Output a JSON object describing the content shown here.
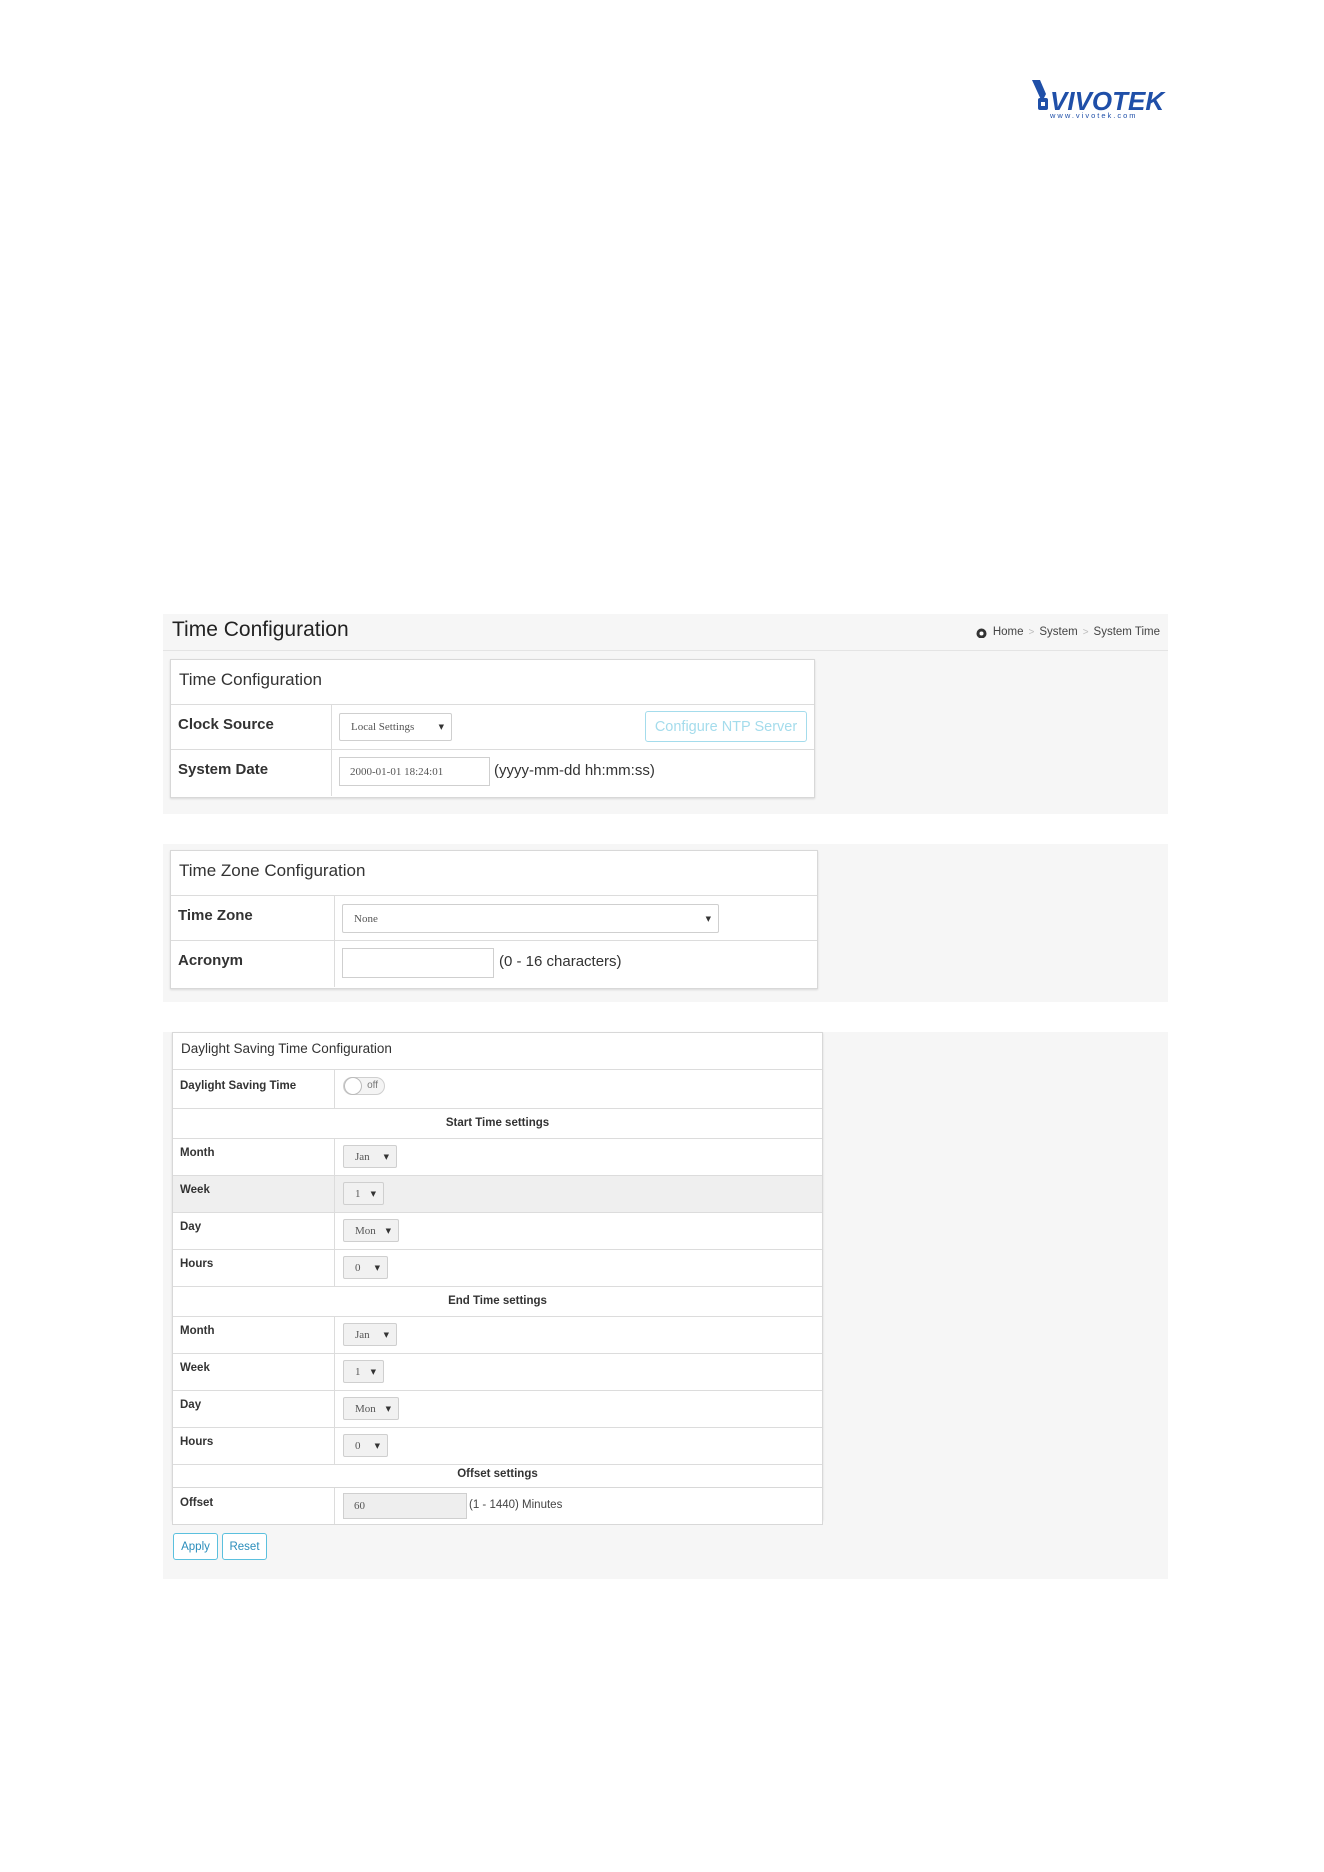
{
  "logo": {
    "brand": "VIVOTEK",
    "url": "www.vivotek.com"
  },
  "page": {
    "title": "Time Configuration",
    "breadcrumb": [
      "Home",
      "System",
      "System Time"
    ]
  },
  "time_config": {
    "title": "Time Configuration",
    "clock_source": {
      "label": "Clock Source",
      "value": "Local Settings",
      "ntp_button": "Configure NTP Server"
    },
    "system_date": {
      "label": "System Date",
      "value": "2000-01-01 18:24:01",
      "hint": "(yyyy-mm-dd hh:mm:ss)"
    }
  },
  "time_zone": {
    "title": "Time Zone Configuration",
    "zone": {
      "label": "Time Zone",
      "value": "None"
    },
    "acronym": {
      "label": "Acronym",
      "value": "",
      "hint": "(0 - 16 characters)"
    }
  },
  "dst": {
    "title": "Daylight Saving Time Configuration",
    "toggle": {
      "label": "Daylight Saving Time",
      "state": "off"
    },
    "start": {
      "header": "Start Time settings",
      "month": {
        "label": "Month",
        "value": "Jan"
      },
      "week": {
        "label": "Week",
        "value": "1"
      },
      "day": {
        "label": "Day",
        "value": "Mon"
      },
      "hours": {
        "label": "Hours",
        "value": "0"
      }
    },
    "end": {
      "header": "End Time settings",
      "month": {
        "label": "Month",
        "value": "Jan"
      },
      "week": {
        "label": "Week",
        "value": "1"
      },
      "day": {
        "label": "Day",
        "value": "Mon"
      },
      "hours": {
        "label": "Hours",
        "value": "0"
      }
    },
    "offset": {
      "header": "Offset settings",
      "label": "Offset",
      "value": "60",
      "hint": "(1 - 1440) Minutes"
    }
  },
  "actions": {
    "apply": "Apply",
    "reset": "Reset"
  },
  "colors": {
    "accent": "#5bc0de",
    "brand": "#1f4fa8"
  }
}
